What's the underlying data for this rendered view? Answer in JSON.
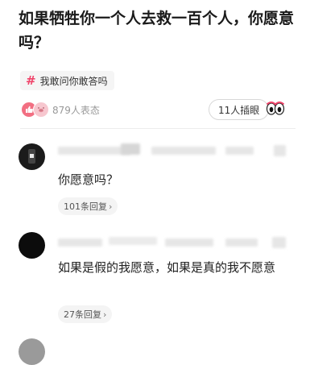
{
  "post": {
    "title": "如果牺牲你一个人去救一百个人，你愿意吗？"
  },
  "topic": {
    "icon": "hash-icon",
    "label": "我敢问你敢答吗"
  },
  "stats": {
    "reaction_icons": [
      "like-icon",
      "pig-face-icon"
    ],
    "reaction_count": "879人表态",
    "insert_label": "11人插眼",
    "insert_icon": "eyes-icon"
  },
  "comments": [
    {
      "text": "你愿意吗？",
      "replies": "101条回复"
    },
    {
      "text": "如果是假的我愿意，如果是真的我不愿意",
      "replies": "27条回复"
    }
  ],
  "colors": {
    "accent": "#f0446a",
    "like": "#f26f82"
  }
}
